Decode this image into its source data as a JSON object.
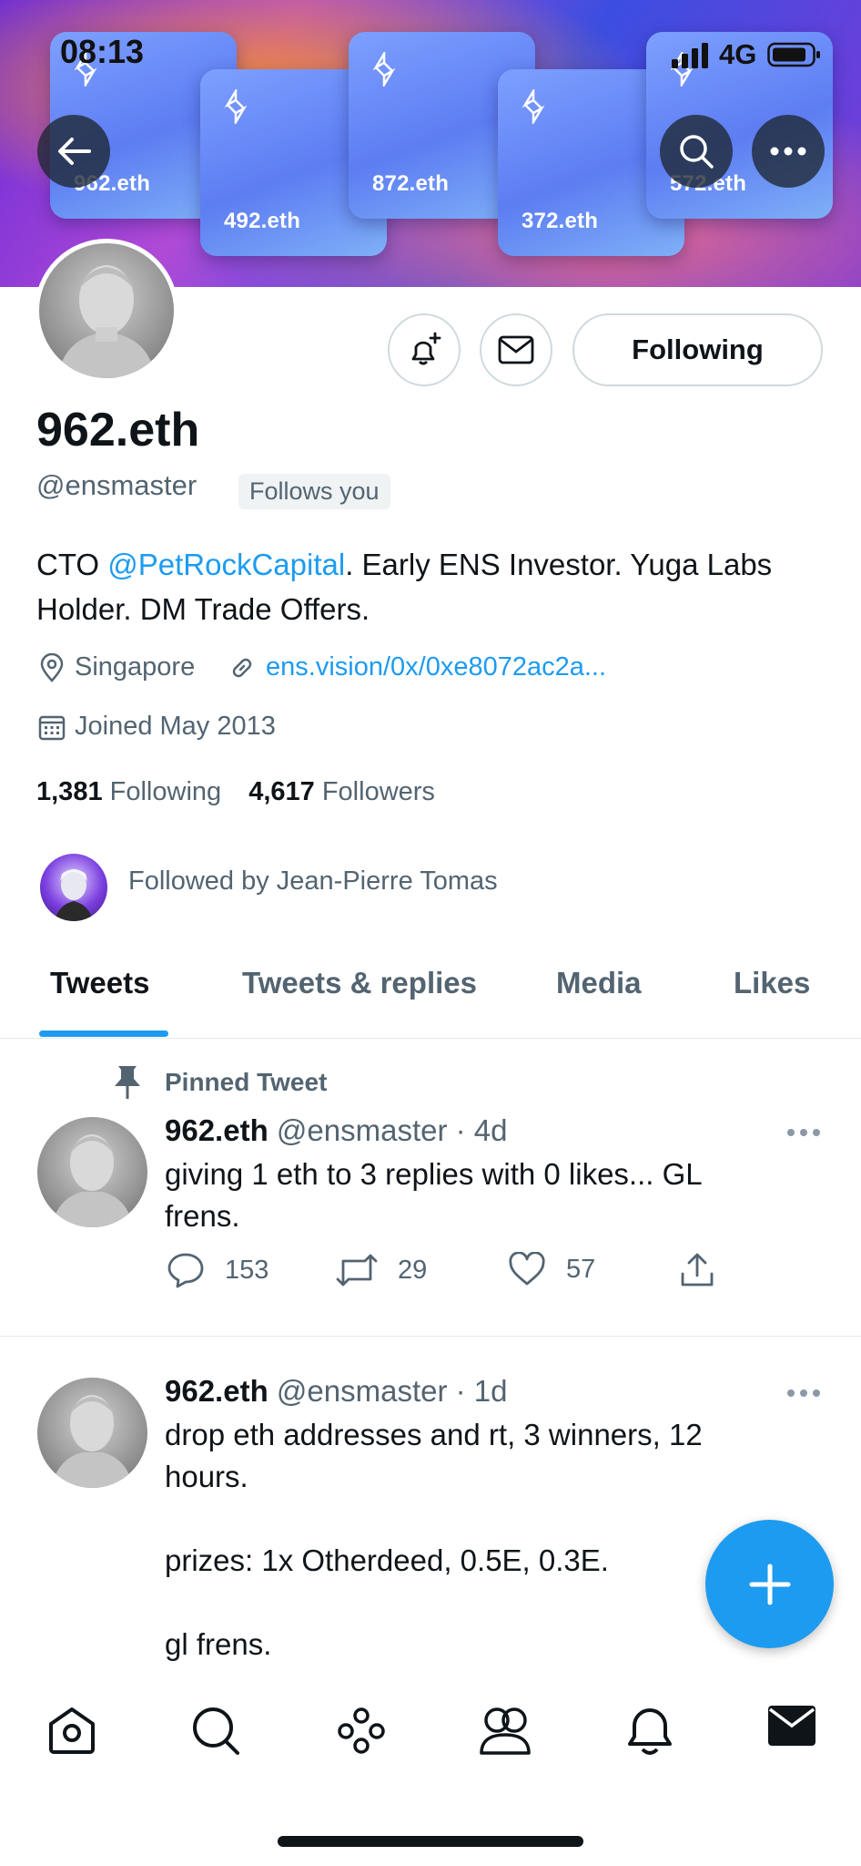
{
  "status_bar": {
    "time": "08:13",
    "network": "4G"
  },
  "banner": {
    "cards": [
      {
        "name": "962.eth"
      },
      {
        "name": "492.eth"
      },
      {
        "name": "872.eth"
      },
      {
        "name": "372.eth"
      },
      {
        "name": "572.eth"
      }
    ]
  },
  "profile": {
    "name": "962.eth",
    "handle": "@ensmaster",
    "follows_you": "Follows you",
    "bio_prefix": "CTO ",
    "bio_mention": "@PetRockCapital",
    "bio_suffix": ". Early ENS Investor. Yuga Labs Holder. DM Trade Offers.",
    "location": "Singapore",
    "website": "ens.vision/0x/0xe8072ac2a...",
    "joined": "Joined May 2013",
    "following_count": "1,381",
    "following_label": "Following",
    "followers_count": "4,617",
    "followers_label": "Followers",
    "followed_by": "Followed by Jean-Pierre Tomas",
    "follow_button": "Following"
  },
  "tabs": [
    {
      "label": "Tweets",
      "active": true
    },
    {
      "label": "Tweets & replies"
    },
    {
      "label": "Media"
    },
    {
      "label": "Likes"
    }
  ],
  "tweets": [
    {
      "pinned_label": "Pinned Tweet",
      "name": "962.eth",
      "handle": "@ensmaster",
      "time": "· 4d",
      "text": "giving 1 eth to 3 replies with 0 likes... GL frens.",
      "replies": "153",
      "retweets": "29",
      "likes": "57"
    },
    {
      "name": "962.eth",
      "handle": "@ensmaster",
      "time": "· 1d",
      "text_lines": [
        "drop eth addresses and rt, 3 winners, 12 hours.",
        "",
        "prizes: 1x Otherdeed, 0.5E, 0.3E.",
        "",
        "gl frens."
      ]
    }
  ],
  "colors": {
    "accent": "#1d9bf0",
    "text": "#0f1419",
    "muted": "#536471"
  }
}
